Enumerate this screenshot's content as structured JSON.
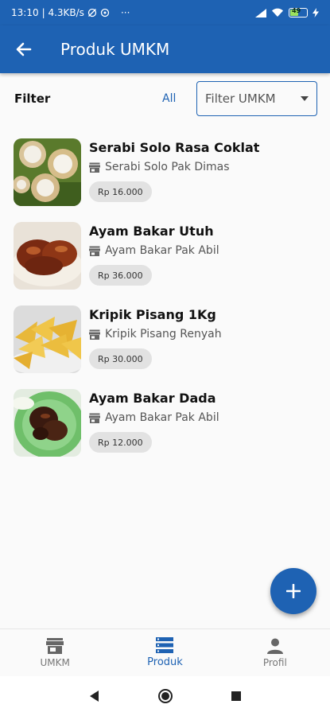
{
  "status_bar": {
    "time": "13:10",
    "net_speed": "| 4.3KB/s",
    "more": "···",
    "battery": "49"
  },
  "app_bar": {
    "title": "Produk UMKM"
  },
  "filter": {
    "label": "Filter",
    "all_label": "All",
    "select_value": "Filter UMKM"
  },
  "products": [
    {
      "name": "Serabi Solo Rasa Coklat",
      "shop": "Serabi Solo Pak Dimas",
      "price": "Rp 16.000",
      "image": "serabi-photo"
    },
    {
      "name": "Ayam Bakar Utuh",
      "shop": "Ayam Bakar Pak Abil",
      "price": "Rp 36.000",
      "image": "grilled-chicken-photo"
    },
    {
      "name": "Kripik Pisang 1Kg",
      "shop": "Kripik Pisang Renyah",
      "price": "Rp 30.000",
      "image": "banana-chips-photo"
    },
    {
      "name": "Ayam Bakar Dada",
      "shop": "Ayam Bakar Pak Abil",
      "price": "Rp 12.000",
      "image": "chicken-breast-photo"
    }
  ],
  "bottom_nav": {
    "items": [
      {
        "label": "UMKM",
        "icon": "store-icon",
        "active": false
      },
      {
        "label": "Produk",
        "icon": "list-icon",
        "active": true
      },
      {
        "label": "Profil",
        "icon": "person-icon",
        "active": false
      }
    ]
  },
  "colors": {
    "primary": "#1e62b3",
    "chip_bg": "#e2e2e2"
  }
}
